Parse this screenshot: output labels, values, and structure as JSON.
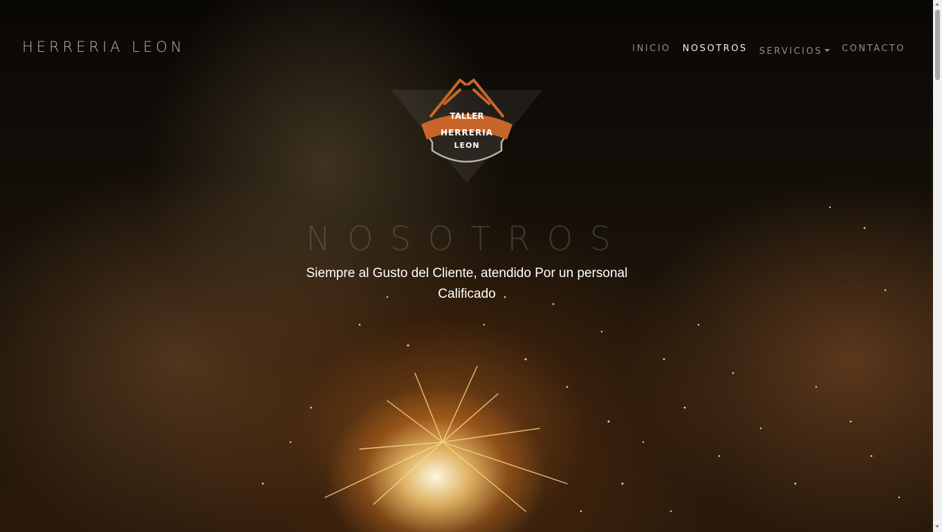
{
  "site": {
    "brand": "HERRERIA LEON"
  },
  "nav": {
    "items": [
      {
        "label": "INICIO",
        "active": false
      },
      {
        "label": "NOSOTROS",
        "active": true
      },
      {
        "label": "SERVICIOS",
        "active": false,
        "dropdown": true
      },
      {
        "label": "CONTACTO",
        "active": false
      }
    ]
  },
  "logo": {
    "line1": "TALLER",
    "line2": "HERRERIA",
    "line3": "LEON",
    "accent_color": "#c8652a"
  },
  "hero": {
    "title": "NOSOTROS",
    "subtitle": "Siempre al Gusto del Cliente, atendido Por un personal Calificado",
    "background_description_icon": "welding-photo"
  }
}
